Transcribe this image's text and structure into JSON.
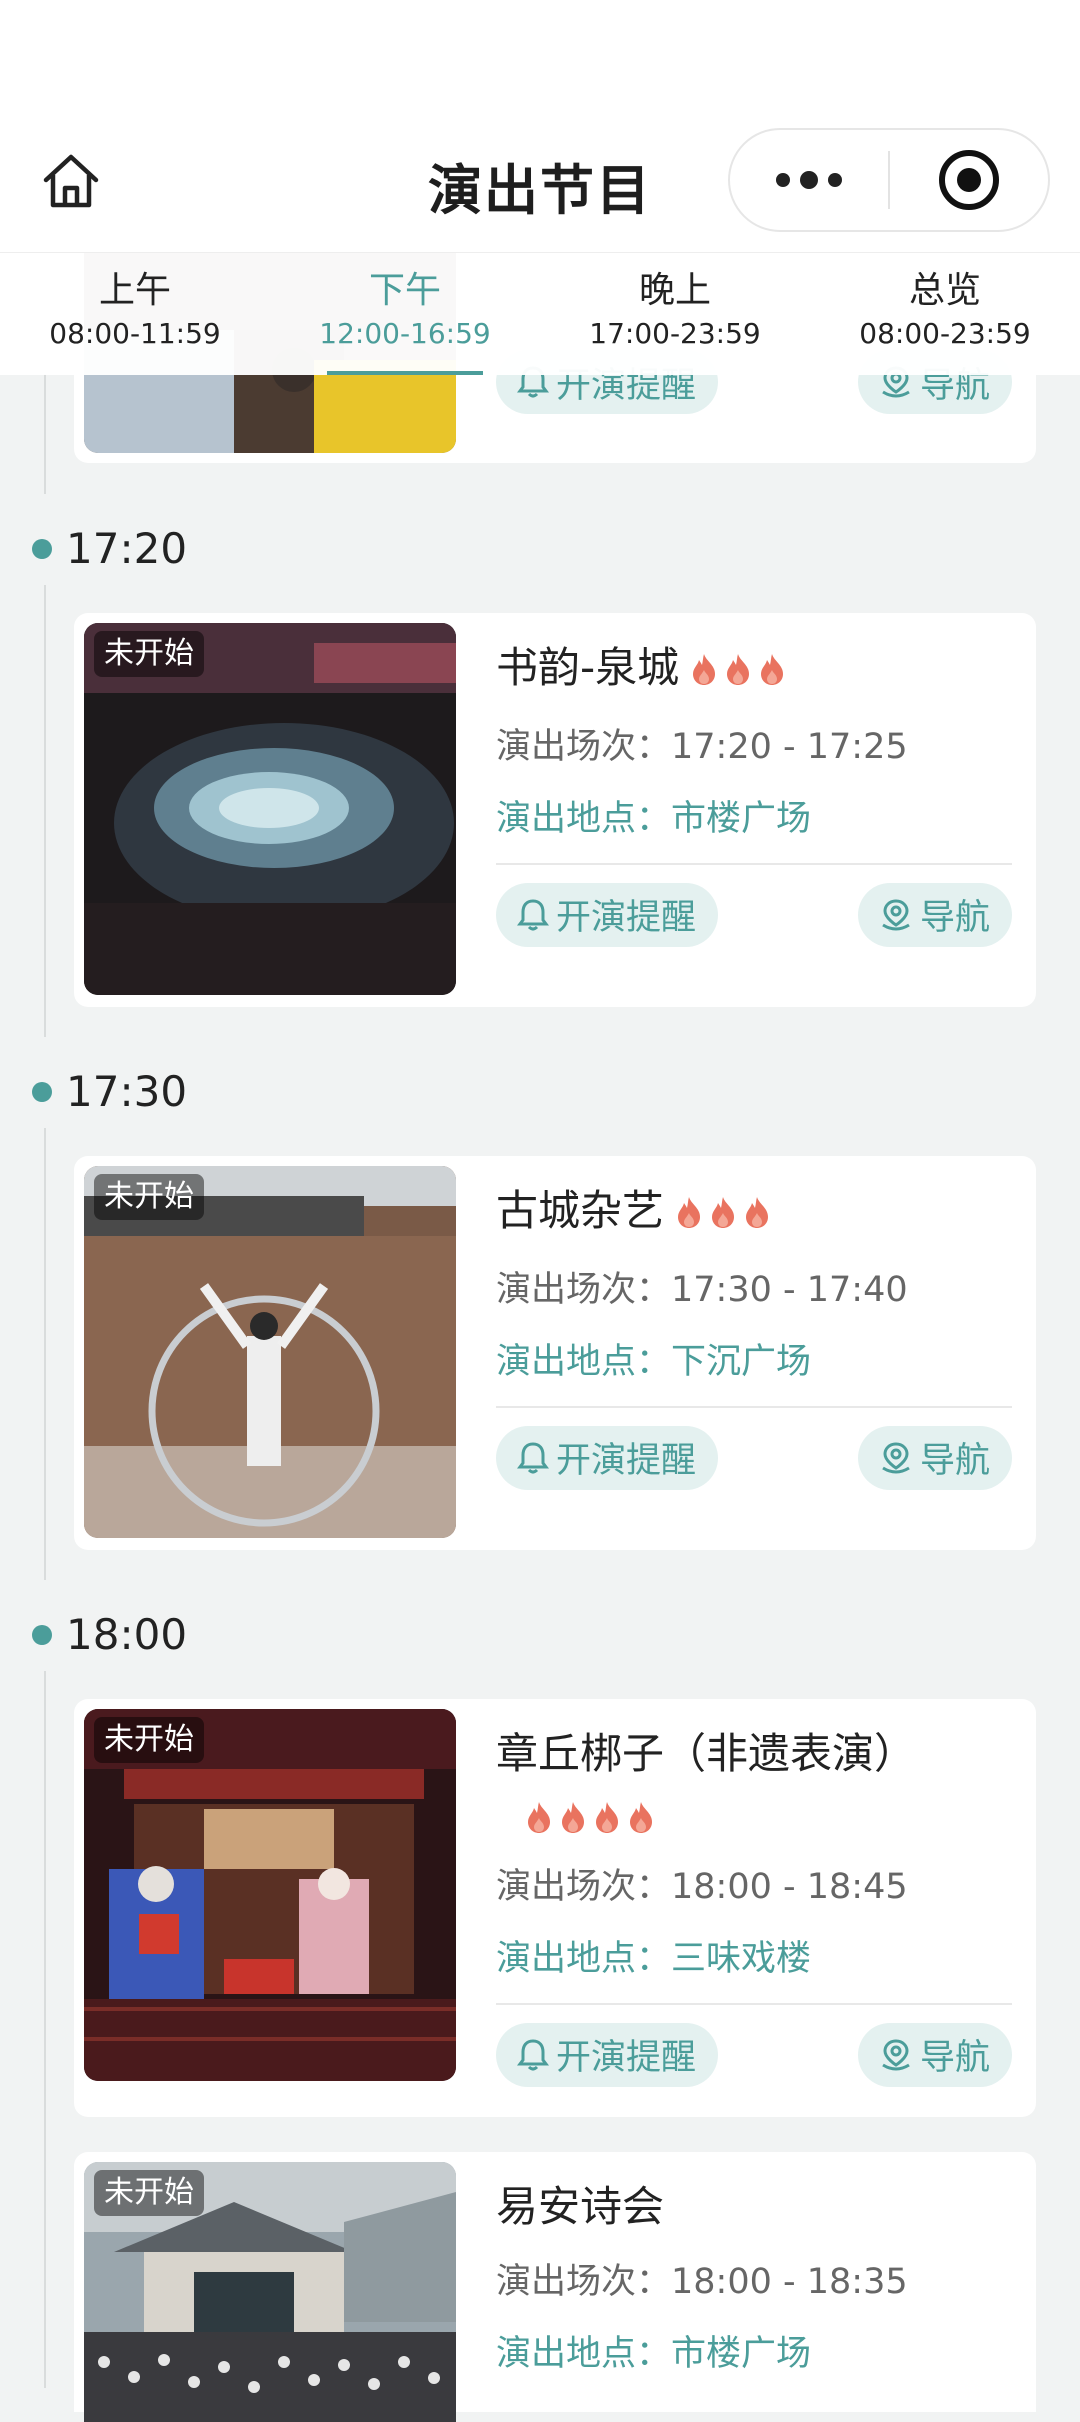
{
  "nav": {
    "title": "演出节目",
    "home_icon": "home-icon",
    "more_icon": "more-dots-icon",
    "close_icon": "target-circle-icon"
  },
  "tabs": [
    {
      "label": "上午",
      "range": "08:00-11:59",
      "active": false
    },
    {
      "label": "下午",
      "range": "12:00-16:59",
      "active": true
    },
    {
      "label": "晚上",
      "range": "17:00-23:59",
      "active": false
    },
    {
      "label": "总览",
      "range": "08:00-23:59",
      "active": false
    }
  ],
  "labels": {
    "session": "演出场次：",
    "location": "演出地点：",
    "remind": "开演提醒",
    "navigate": "导航",
    "status": "未开始"
  },
  "partial_card": {
    "remind": "开演提醒",
    "navigate": "导航"
  },
  "groups": [
    {
      "time": "17:20",
      "shows": [
        {
          "title": "书韵-泉城",
          "hot": 3,
          "session": "17:20 - 17:25",
          "location": "市楼广场",
          "status": "未开始"
        }
      ]
    },
    {
      "time": "17:30",
      "shows": [
        {
          "title": "古城杂艺",
          "hot": 3,
          "session": "17:30 - 17:40",
          "location": "下沉广场",
          "status": "未开始"
        }
      ]
    },
    {
      "time": "18:00",
      "shows": [
        {
          "title": "章丘梆子（非遗表演）",
          "hot": 4,
          "session": "18:00 - 18:45",
          "location": "三味戏楼",
          "status": "未开始"
        },
        {
          "title": "易安诗会",
          "hot": 0,
          "session": "18:00 - 18:35",
          "location": "市楼广场",
          "status": "未开始"
        }
      ]
    }
  ],
  "colors": {
    "accent": "#4b9d9a",
    "pill_bg": "#e4f1f0",
    "flame": "#e9735f",
    "page_bg": "#f1f3f3"
  }
}
